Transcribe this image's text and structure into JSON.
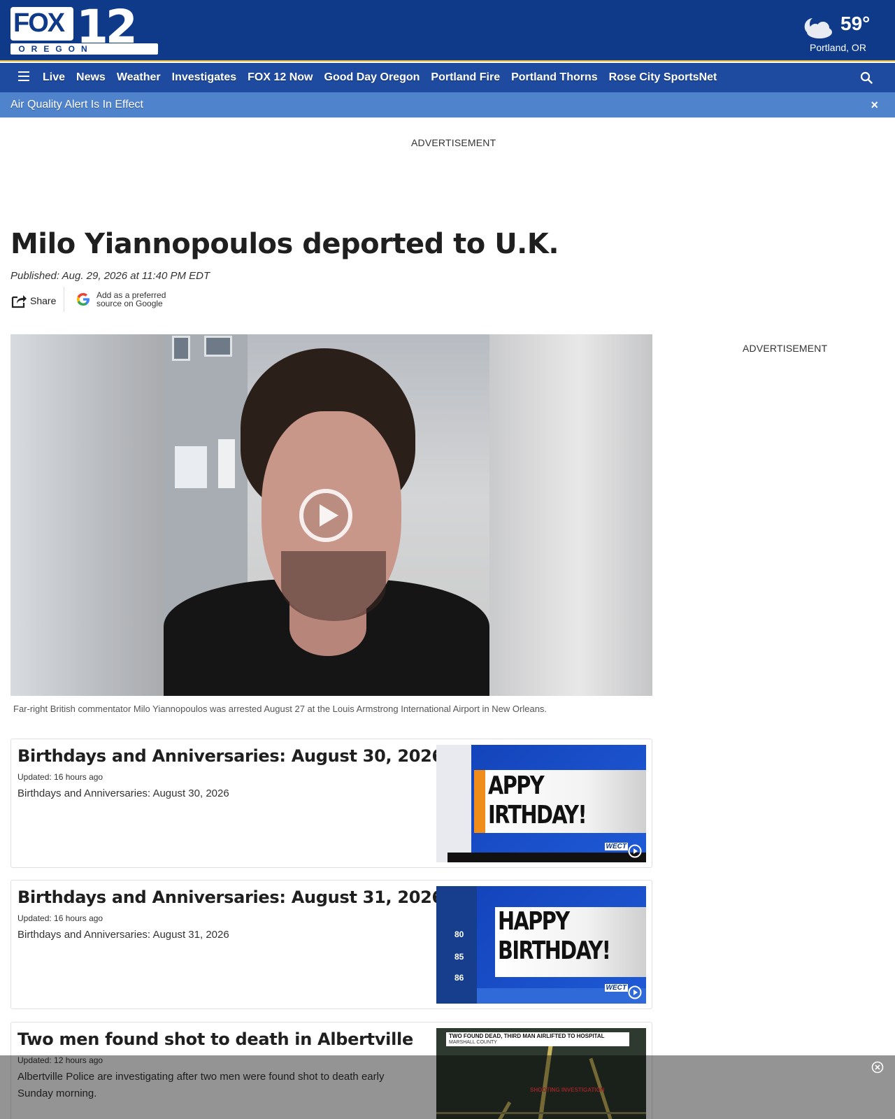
{
  "header": {
    "logo_text": "FOX 12",
    "logo_sub": "OREGON",
    "weather": {
      "temp": "59°",
      "location": "Portland, OR",
      "icon": "partly-cloudy-night-icon"
    }
  },
  "nav": {
    "items": [
      "Live",
      "News",
      "Weather",
      "Investigates",
      "FOX 12 Now",
      "Good Day Oregon",
      "Portland Fire",
      "Portland Thorns",
      "Rose City SportsNet"
    ]
  },
  "alert": {
    "text": "Air Quality Alert Is In Effect",
    "close": "×"
  },
  "ads": {
    "top": "ADVERTISEMENT",
    "side": "ADVERTISEMENT"
  },
  "article": {
    "headline": "Milo Yiannopoulos deported to U.K.",
    "published": "Published: Aug. 29, 2026 at 11:40 PM EDT",
    "share_label": "Share",
    "google_source": "Add as a preferred source on Google",
    "caption": "Far-right British commentator Milo Yiannopoulos was arrested August 27 at the Louis Armstrong International Airport in New Orleans."
  },
  "cards": [
    {
      "title": "Birthdays and Anniversaries: August 30, 2026",
      "updated": "Updated: 16 hours ago",
      "description": "Birthdays and Anniversaries: August 30, 2026",
      "thumb_text": "APPY\nIRTHDAY!",
      "thumb_brand": "WECT"
    },
    {
      "title": "Birthdays and Anniversaries: August 31, 2026",
      "updated": "Updated: 16 hours ago",
      "description": "Birthdays and Anniversaries: August 31, 2026",
      "thumb_text": "HAPPY\nBIRTHDAY!",
      "thumb_brand": "WECT",
      "thumb_temps": [
        "80",
        "85",
        "86"
      ]
    },
    {
      "title": "Two men found shot to death in Albertville",
      "updated": "Updated: 12 hours ago",
      "description": "Albertville Police are investigating after two men were found shot to death early Sunday morning.",
      "thumb_title": "TWO FOUND DEAD, THIRD MAN AIRLIFTED TO HOSPITAL",
      "thumb_sub": "MARSHALL COUNTY",
      "thumb_label": "SHOOTING INVESTIGATION"
    }
  ],
  "colors": {
    "brand": "#0f3a8a",
    "nav": "#1e4aa0",
    "alert": "#4f83cc"
  }
}
